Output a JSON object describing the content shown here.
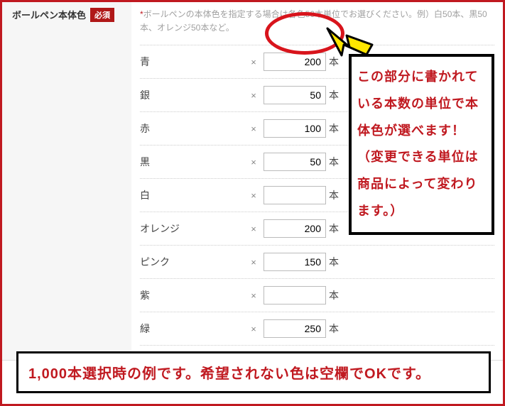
{
  "section": {
    "title": "ボールペン本体色",
    "required_badge": "必須",
    "note_prefix": "*",
    "note_text": "ボールペンの本体色を指定する場合は各色50本単位でお選びください。例）白50本、黒50本、オレンジ50本など。"
  },
  "rows": [
    {
      "label": "青",
      "value": "200",
      "unit": "本"
    },
    {
      "label": "銀",
      "value": "50",
      "unit": "本"
    },
    {
      "label": "赤",
      "value": "100",
      "unit": "本"
    },
    {
      "label": "黒",
      "value": "50",
      "unit": "本"
    },
    {
      "label": "白",
      "value": "",
      "unit": "本"
    },
    {
      "label": "オレンジ",
      "value": "200",
      "unit": "本"
    },
    {
      "label": "ピンク",
      "value": "150",
      "unit": "本"
    },
    {
      "label": "紫",
      "value": "",
      "unit": "本"
    },
    {
      "label": "緑",
      "value": "250",
      "unit": "本"
    }
  ],
  "multiply_symbol": "×",
  "callout_text": "この部分に書かれている本数の単位で本体色が選べます！（変更できる単位は商品によって変わります。）",
  "bottom_text": "1,000本選択時の例です。希望されない色は空欄でOKです。"
}
